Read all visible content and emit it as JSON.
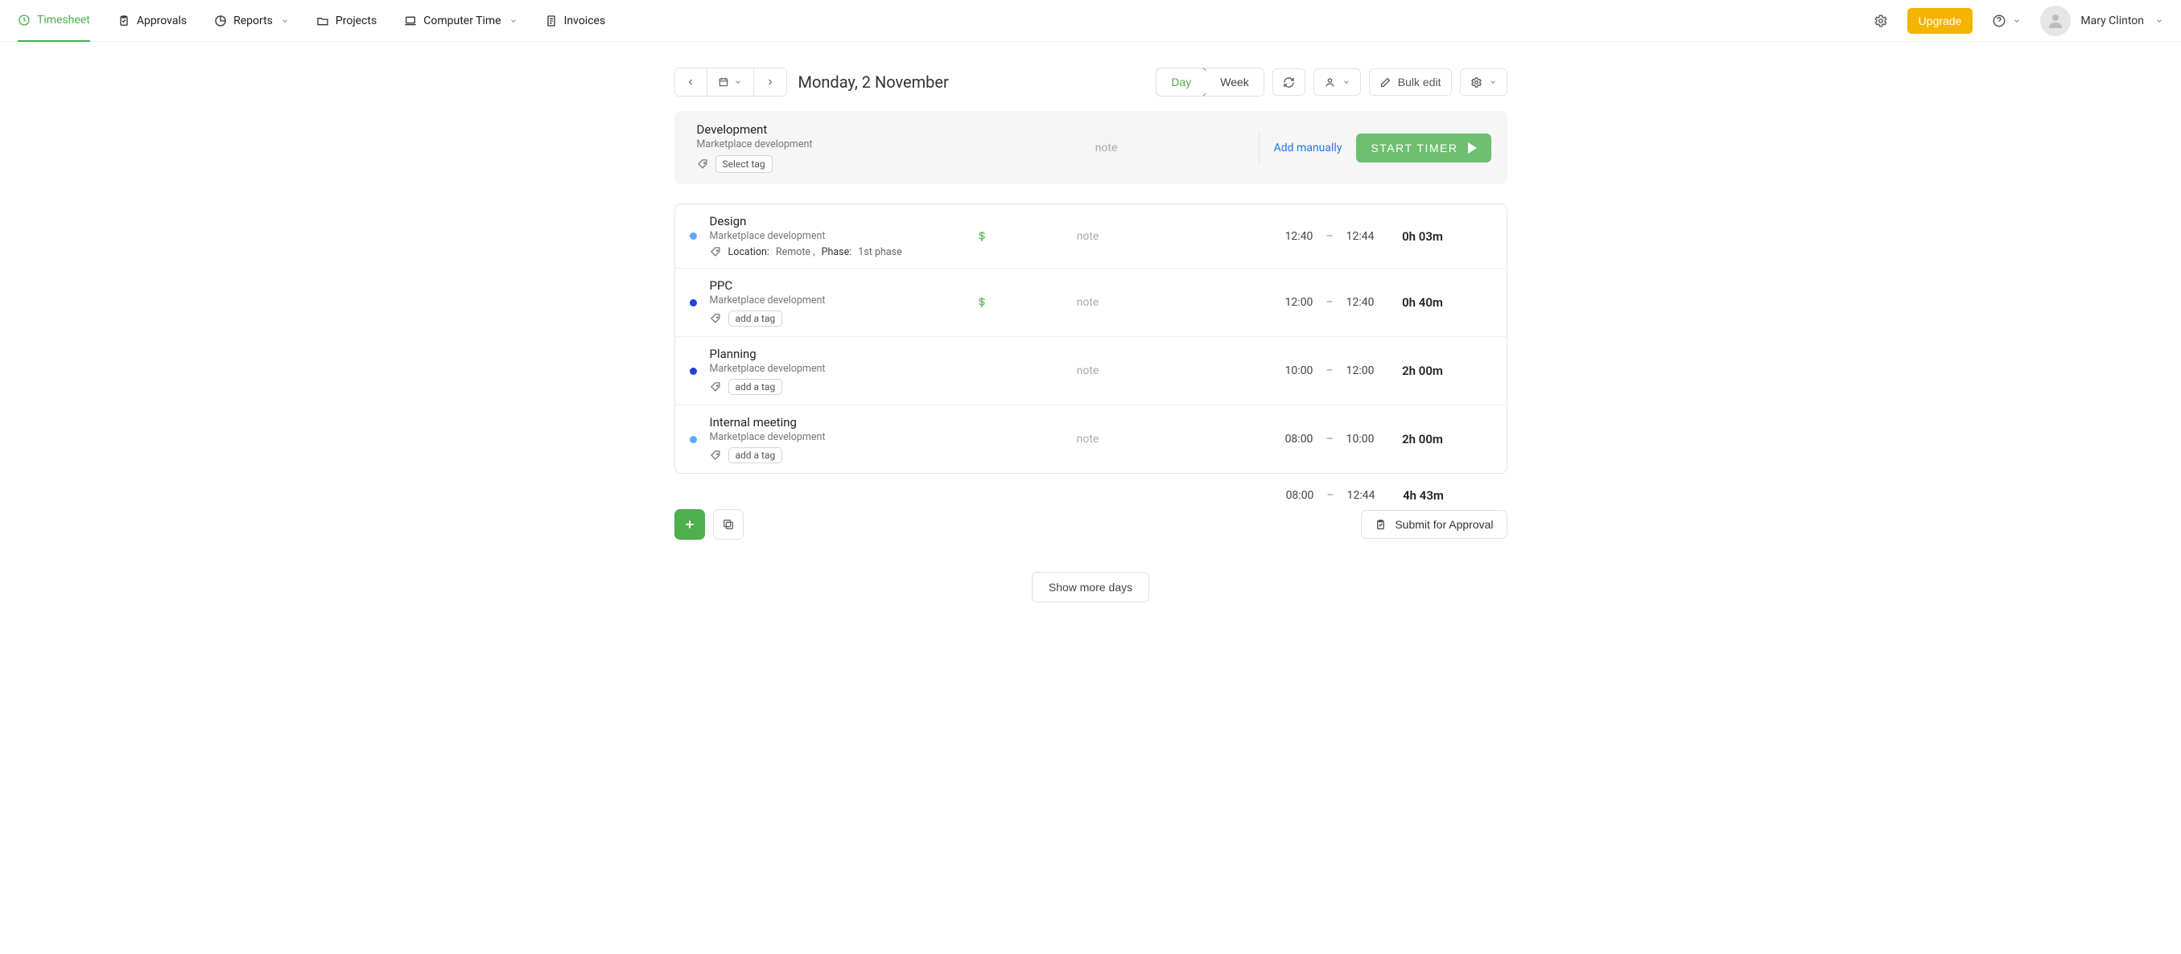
{
  "nav": {
    "timesheet": "Timesheet",
    "approvals": "Approvals",
    "reports": "Reports",
    "projects": "Projects",
    "computer_time": "Computer Time",
    "invoices": "Invoices",
    "upgrade": "Upgrade",
    "username": "Mary Clinton"
  },
  "date": {
    "title": "Monday, 2 November",
    "view_day": "Day",
    "view_week": "Week",
    "bulk_edit": "Bulk edit"
  },
  "timer": {
    "task": "Development",
    "project": "Marketplace development",
    "select_tag": "Select tag",
    "note": "note",
    "add_manually": "Add manually",
    "start_timer": "START TIMER"
  },
  "entries": [
    {
      "dot": "blue1",
      "task": "Design",
      "project": "Marketplace development",
      "tags_text": "",
      "tags_pairs": [
        {
          "k": "Location:",
          "v": "Remote"
        },
        {
          "k": "Phase:",
          "v": "1st phase"
        }
      ],
      "billable": true,
      "note": "note",
      "start": "12:40",
      "end": "12:44",
      "duration": "0h 03m"
    },
    {
      "dot": "blue2",
      "task": "PPC",
      "project": "Marketplace development",
      "add_tag": "add a tag",
      "billable": true,
      "note": "note",
      "start": "12:00",
      "end": "12:40",
      "duration": "0h 40m"
    },
    {
      "dot": "blue3",
      "task": "Planning",
      "project": "Marketplace development",
      "add_tag": "add a tag",
      "billable": false,
      "note": "note",
      "start": "10:00",
      "end": "12:00",
      "duration": "2h 00m"
    },
    {
      "dot": "blue4",
      "task": "Internal meeting",
      "project": "Marketplace development",
      "add_tag": "add a tag",
      "billable": false,
      "note": "note",
      "start": "08:00",
      "end": "10:00",
      "duration": "2h 00m"
    }
  ],
  "totals": {
    "start": "08:00",
    "end": "12:44",
    "duration": "4h 43m"
  },
  "actions": {
    "submit": "Submit for Approval",
    "show_more": "Show more days"
  }
}
